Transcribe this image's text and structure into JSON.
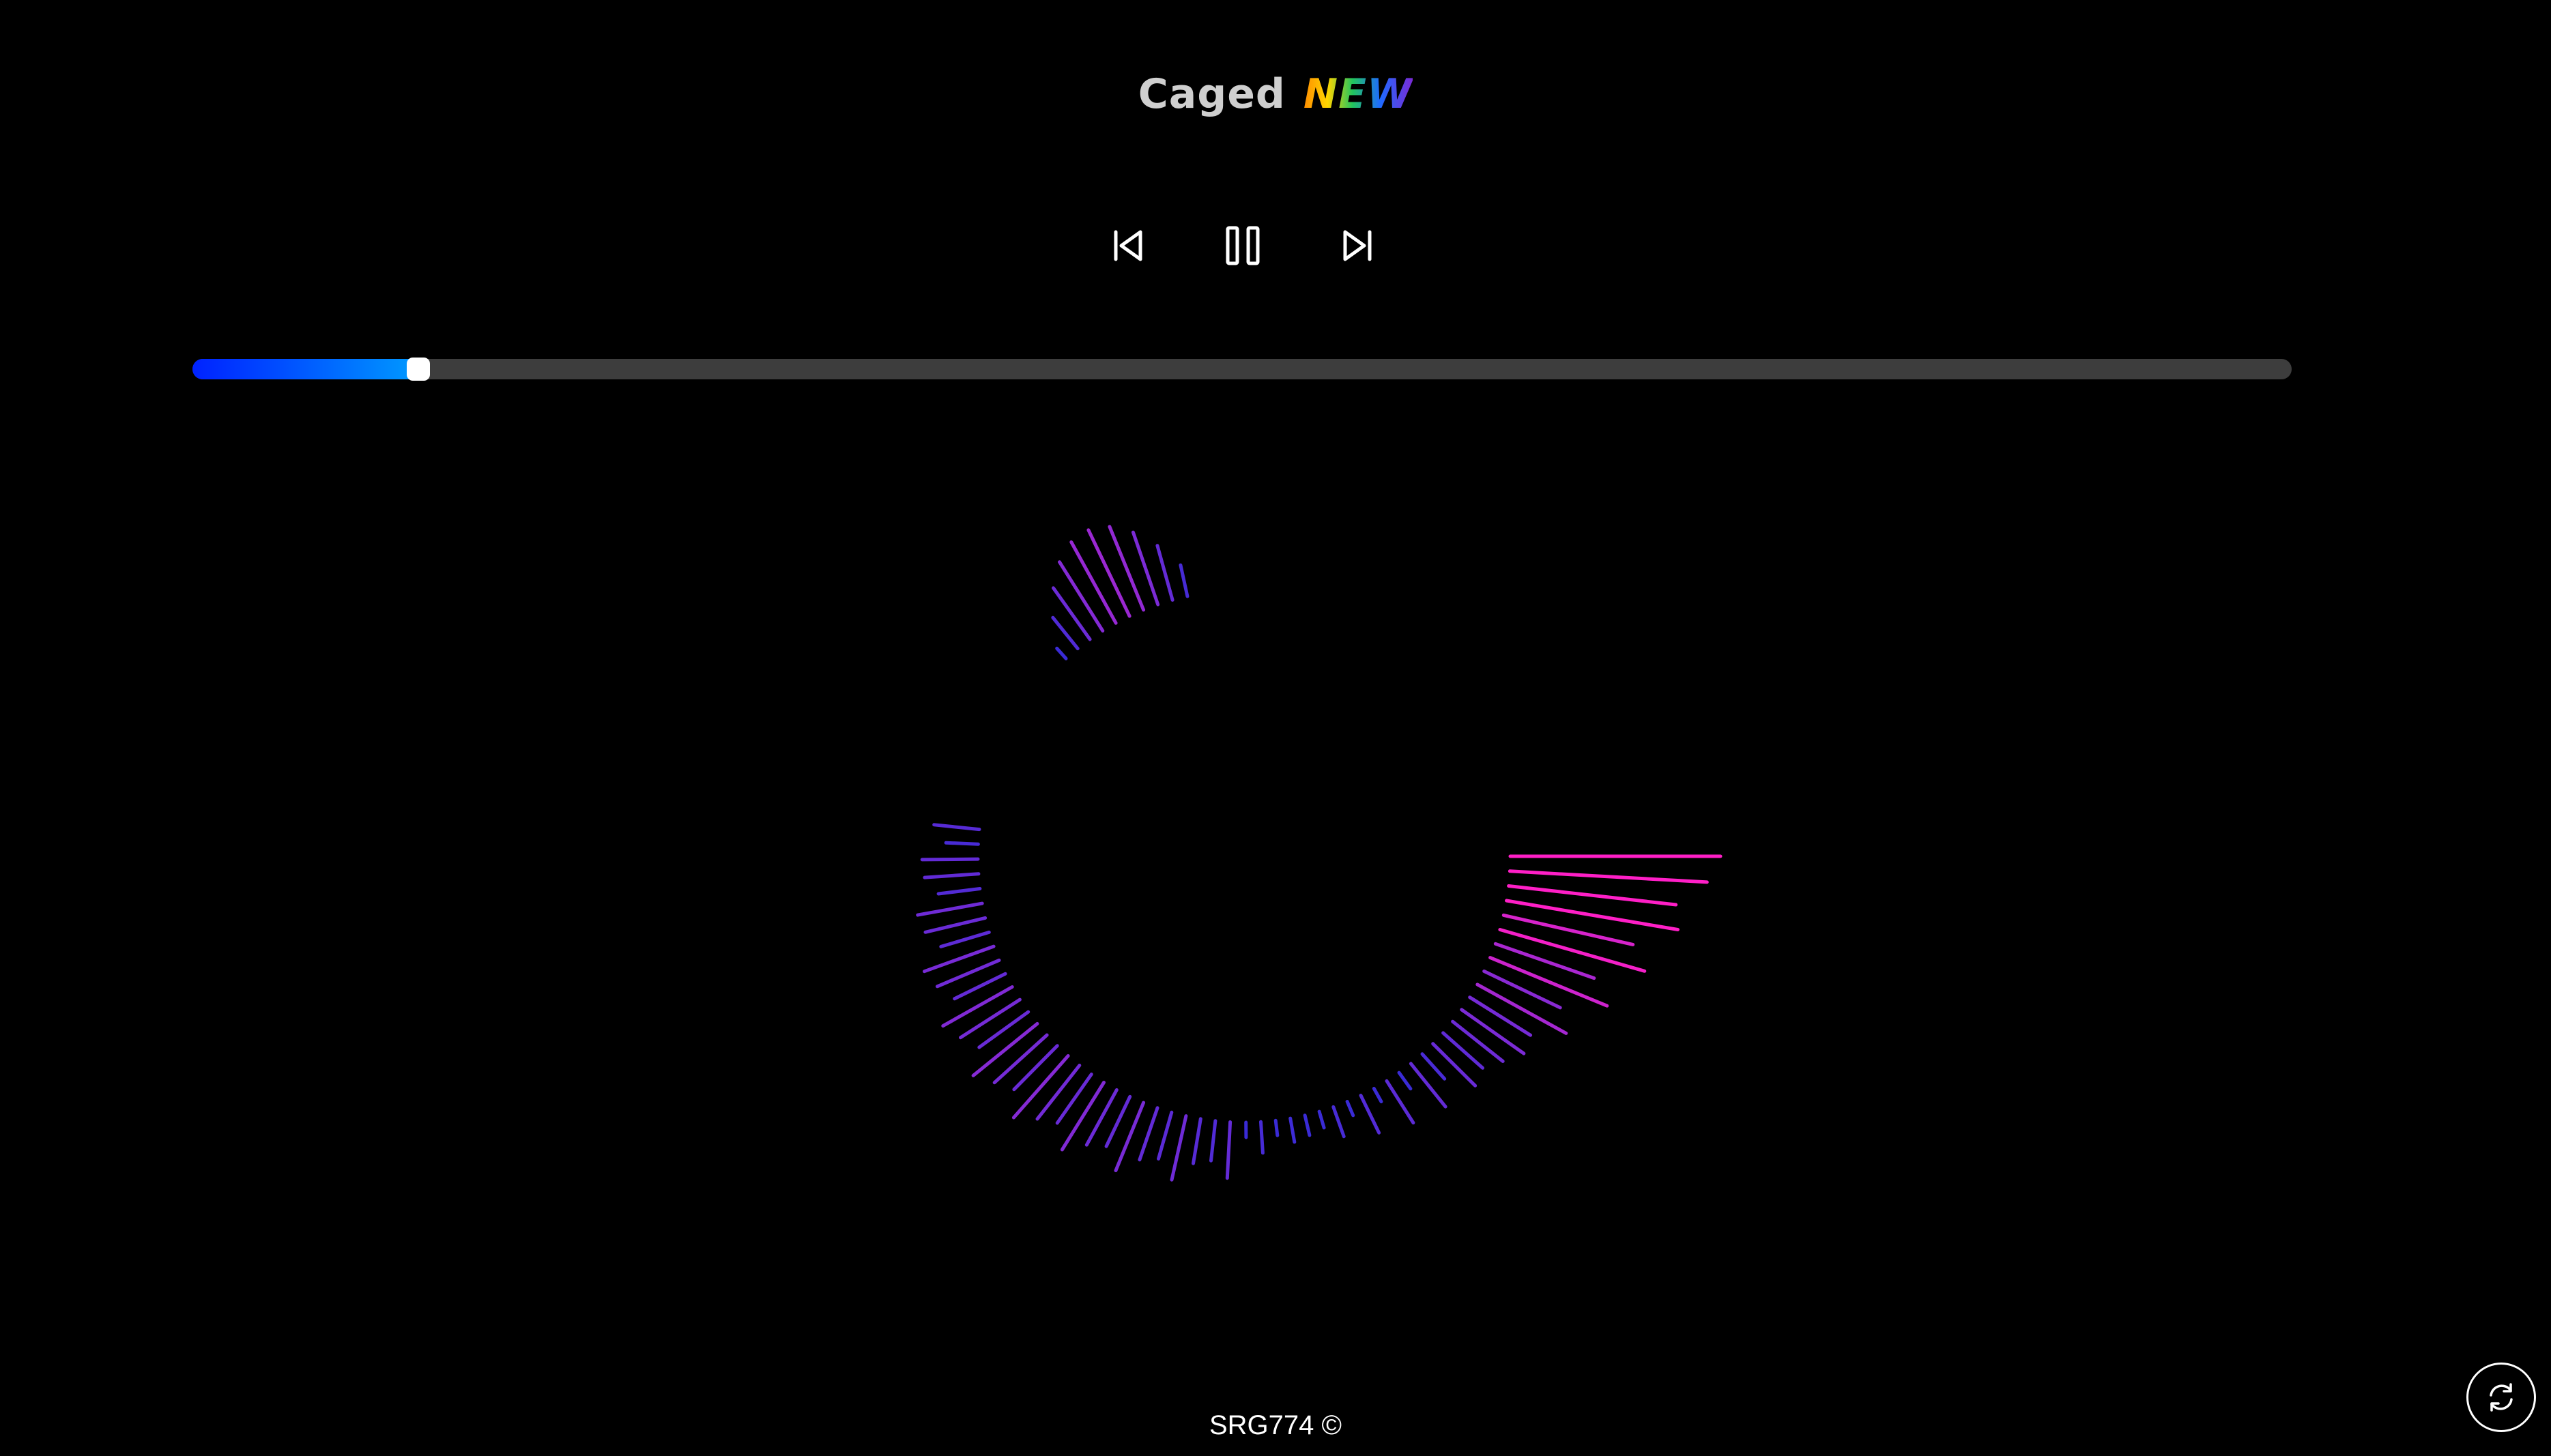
{
  "header": {
    "song_title": "Caged",
    "badge": "NEW"
  },
  "controls": {
    "previous_icon": "skip-previous-icon",
    "pause_icon": "pause-icon",
    "next_icon": "skip-next-icon"
  },
  "progress": {
    "fraction": 0.107
  },
  "visualizer": {
    "type": "circular-bars",
    "colors": {
      "low": "#3a2bd6",
      "mid": "#7a2bd6",
      "high": "#ff1fc7"
    }
  },
  "footer": {
    "copyright": "SRG774 ©"
  },
  "actions": {
    "refresh_icon": "refresh-icon"
  },
  "colors": {
    "background": "#000000",
    "track": "#3d3d3d",
    "accent": "#0050ff"
  }
}
